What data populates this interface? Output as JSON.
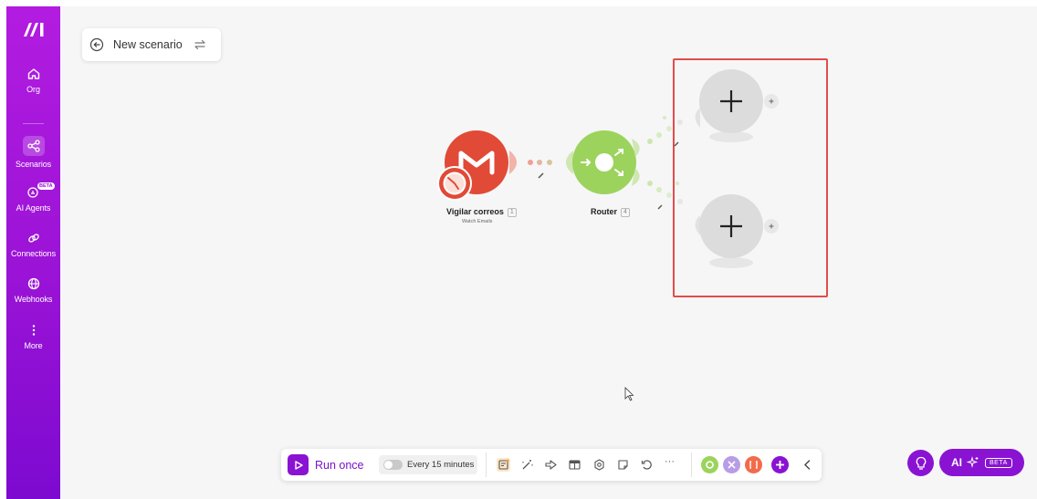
{
  "sidebar": {
    "items": [
      {
        "label": "Org",
        "icon": "home-icon"
      },
      {
        "label": "Scenarios",
        "icon": "share-nodes-icon"
      },
      {
        "label": "AI Agents",
        "icon": "ai-agent-icon",
        "badge": "BETA"
      },
      {
        "label": "Connections",
        "icon": "link-icon"
      },
      {
        "label": "Webhooks",
        "icon": "globe-icon"
      },
      {
        "label": "More",
        "icon": "more-vertical-icon"
      }
    ]
  },
  "header": {
    "title": "New scenario"
  },
  "modules": {
    "gmail": {
      "label": "Vigilar correos",
      "badge": "1",
      "sub": "Watch Emails",
      "color": "#e14a36"
    },
    "router": {
      "label": "Router",
      "badge": "4",
      "color": "#9cd35d"
    }
  },
  "toolbar": {
    "run_label": "Run once",
    "schedule_label": "Every 15 minutes",
    "more_label": "···"
  },
  "ai_button": {
    "label": "AI",
    "badge": "BETA"
  },
  "colors": {
    "brand": "#8a13d3",
    "sidebar_top": "#b21ce0",
    "highlight": "#e24c4c"
  }
}
